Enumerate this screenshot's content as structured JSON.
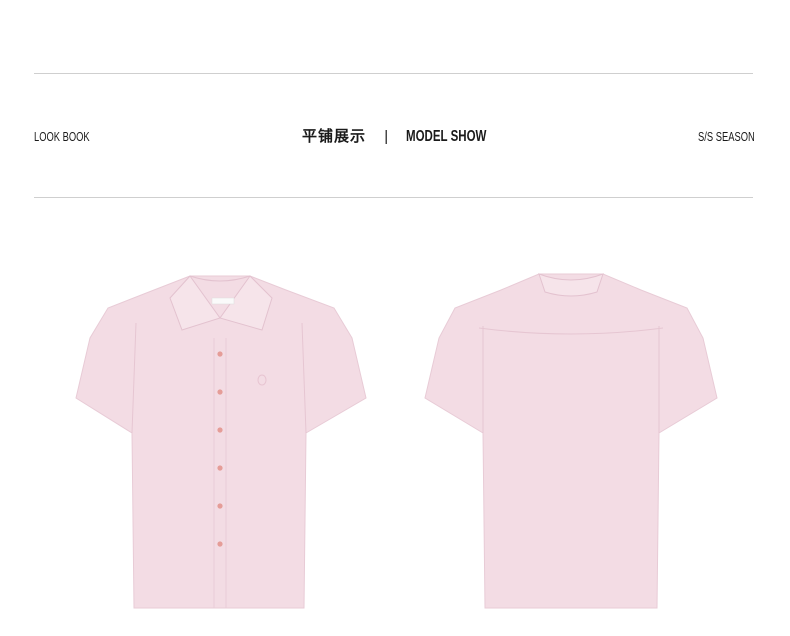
{
  "header": {
    "left_label": "LOOK BOOK",
    "title_zh": "平铺展示",
    "separator": "|",
    "title_en": "MODEL SHOW",
    "right_label": "S/S SEASON"
  },
  "colors": {
    "shirt": "#f3dce4",
    "shirt_shadow": "#e9c9d5",
    "button": "#e59d98",
    "rule": "#cfcfcf"
  },
  "images": {
    "front": "pink-short-sleeve-shirt-front",
    "back": "pink-short-sleeve-shirt-back"
  }
}
